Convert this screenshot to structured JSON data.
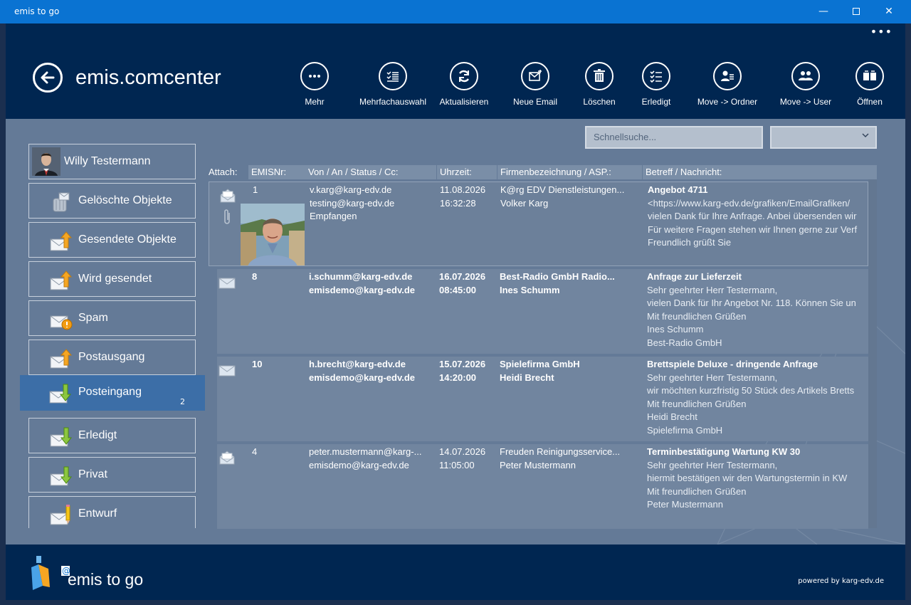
{
  "window": {
    "title": "emis to go",
    "minimize": "—",
    "close": "✕"
  },
  "header": {
    "title": "emis.comcenter",
    "more": "•••"
  },
  "toolbar": [
    {
      "label": "Mehr",
      "icon": "ellipsis-icon"
    },
    {
      "label": "Mehrfachauswahl",
      "icon": "checklist-icon"
    },
    {
      "label": "Aktualisieren",
      "icon": "refresh-icon"
    },
    {
      "label": "Neue Email",
      "icon": "new-mail-icon"
    },
    {
      "label": "Löschen",
      "icon": "trash-icon"
    },
    {
      "label": "Erledigt",
      "icon": "done-list-icon"
    },
    {
      "label": "Move -> Ordner",
      "icon": "move-folder-icon"
    },
    {
      "label": "Move -> User",
      "icon": "move-user-icon"
    },
    {
      "label": "Öffnen",
      "icon": "open-book-icon"
    }
  ],
  "search": {
    "placeholder": "Schnellsuche...",
    "dropdown_icon": "chevron-down-icon"
  },
  "sidebar": {
    "user": "Willy Testermann",
    "folders": [
      {
        "label": "Gelöschte Objekte",
        "icon": "trash-mail-icon"
      },
      {
        "label": "Gesendete Objekte",
        "icon": "mail-up-icon"
      },
      {
        "label": "Wird gesendet",
        "icon": "mail-up-icon"
      },
      {
        "label": "Spam",
        "icon": "mail-warning-icon"
      },
      {
        "label": "Postausgang",
        "icon": "mail-up-icon"
      },
      {
        "label": "Posteingang",
        "icon": "mail-down-icon",
        "count": "2",
        "active": true
      },
      {
        "label": "Erledigt",
        "icon": "mail-down-icon"
      },
      {
        "label": "Privat",
        "icon": "mail-down-icon"
      },
      {
        "label": "Entwurf",
        "icon": "mail-pencil-icon"
      }
    ]
  },
  "table": {
    "columns": {
      "attach": "Attach:",
      "nr": "EMISNr:",
      "from": "Von / An / Status / Cc:",
      "time": "Uhrzeit:",
      "company": "Firmenbezeichnung / ASP.:",
      "subject": "Betreff / Nachricht:"
    },
    "rows": [
      {
        "nr": "1",
        "from": [
          "v.karg@karg-edv.de",
          "testing@karg-edv.de",
          "Empfangen"
        ],
        "date": "11.08.2026",
        "time": "16:32:28",
        "company": "K@rg EDV Dienstleistungen...",
        "contact": "Volker Karg",
        "subject": "Angebot 4711",
        "body": [
          "<https://www.karg-edv.de/grafiken/EmailGrafiken/",
          "vielen Dank für Ihre Anfrage. Anbei übersenden wir",
          "Für weitere Fragen stehen wir Ihnen gerne zur Verf",
          "Freundlich grüßt Sie"
        ]
      },
      {
        "nr": "8",
        "from": [
          "i.schumm@karg-edv.de",
          "emisdemo@karg-edv.de"
        ],
        "date": "16.07.2026",
        "time": "08:45:00",
        "company": "Best-Radio GmbH Radio...",
        "contact": "Ines Schumm",
        "subject": "Anfrage zur Lieferzeit",
        "body": [
          "Sehr geehrter Herr Testermann,",
          "vielen Dank für Ihr Angebot Nr. 118. Können Sie un",
          "Mit freundlichen Grüßen",
          "Ines Schumm",
          "Best-Radio GmbH"
        ]
      },
      {
        "nr": "10",
        "from": [
          "h.brecht@karg-edv.de",
          "emisdemo@karg-edv.de"
        ],
        "date": "15.07.2026",
        "time": "14:20:00",
        "company": "Spielefirma GmbH",
        "contact": "Heidi Brecht",
        "subject": "Brettspiele Deluxe - dringende Anfrage",
        "body": [
          "Sehr geehrter Herr Testermann,",
          "wir möchten kurzfristig 50 Stück des Artikels Bretts",
          "Mit freundlichen Grüßen",
          "Heidi Brecht",
          "Spielefirma GmbH"
        ]
      },
      {
        "nr": "4",
        "from": [
          "peter.mustermann@karg-...",
          "emisdemo@karg-edv.de"
        ],
        "date": "14.07.2026",
        "time": "11:05:00",
        "company": "Freuden Reinigungsservice...",
        "contact": "Peter Mustermann",
        "subject": "Terminbestätigung Wartung KW 30",
        "body": [
          "Sehr geehrter Herr Testermann,",
          "hiermit bestätigen wir den Wartungstermin in KW",
          "Mit freundlichen Grüßen",
          "Peter Mustermann"
        ]
      }
    ]
  },
  "footer": {
    "logo_text": "emis to go",
    "powered": "powered by karg-edv.de"
  },
  "colors": {
    "titlebar": "#0a73d2",
    "header": "#002651",
    "body": "#647a97",
    "active_folder": "#3c6ea7"
  }
}
